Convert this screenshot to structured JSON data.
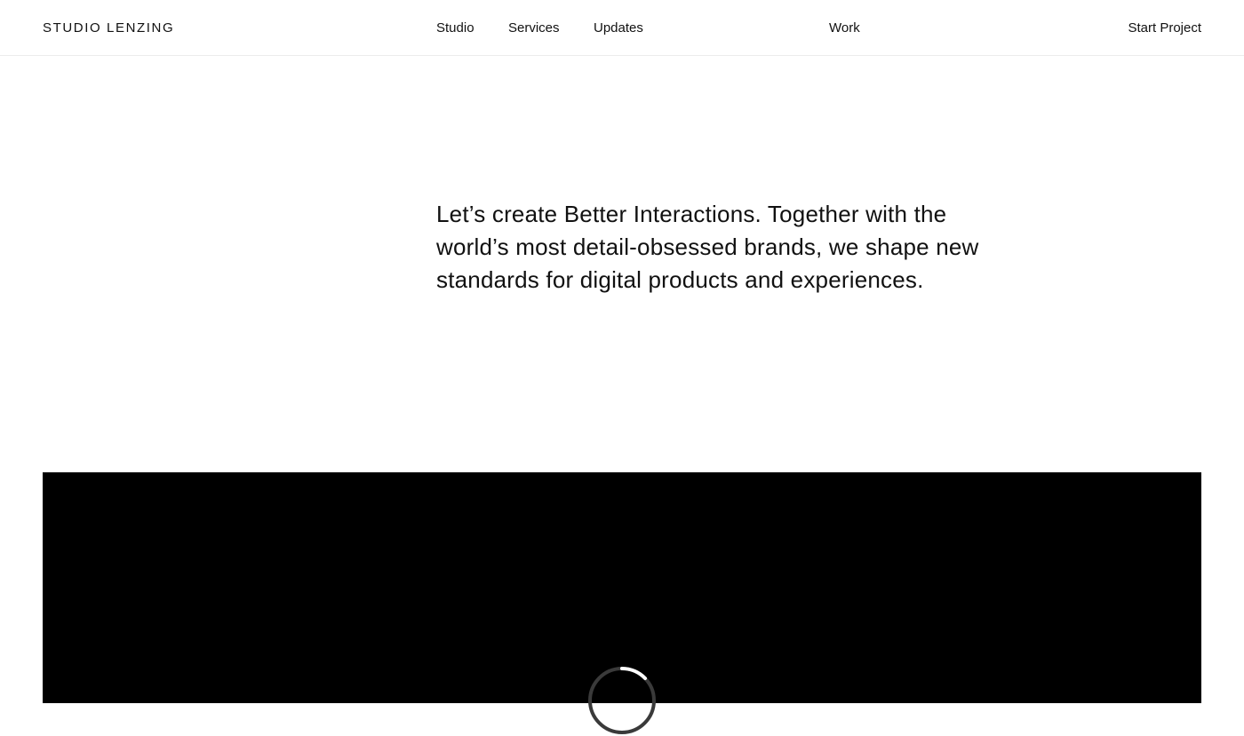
{
  "header": {
    "logo": "STUDIO LENZING",
    "nav": {
      "studio": "Studio",
      "services": "Services",
      "updates": "Updates",
      "work": "Work"
    },
    "cta": "Start Project"
  },
  "hero": {
    "text": "Let’s create Better Interactions. Together with the world’s most detail-obsessed brands, we shape new standards for digital products and experiences."
  },
  "video": {
    "background_color": "#000000",
    "loading_icon": "loading-spinner-icon"
  }
}
